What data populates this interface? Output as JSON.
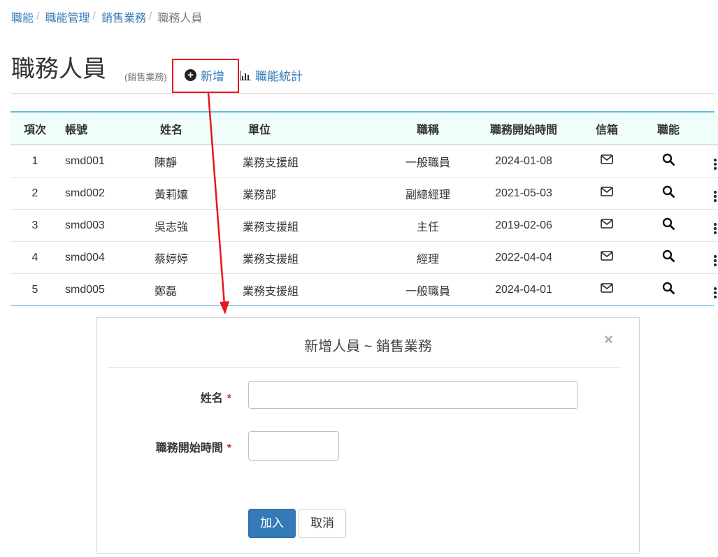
{
  "breadcrumb": {
    "items": [
      "職能",
      "職能管理",
      "銷售業務"
    ],
    "current": "職務人員"
  },
  "header": {
    "title": "職務人員",
    "subtitle": "(銷售業務)",
    "add_label": "新增",
    "stats_label": "職能統計"
  },
  "table": {
    "headers": [
      "項次",
      "帳號",
      "姓名",
      "單位",
      "職稱",
      "職務開始時間",
      "信箱",
      "職能"
    ],
    "rows": [
      {
        "no": "1",
        "account": "smd001",
        "name": "陳靜",
        "unit": "業務支援組",
        "title": "一般職員",
        "start": "2024-01-08"
      },
      {
        "no": "2",
        "account": "smd002",
        "name": "黃莉孃",
        "unit": "業務部",
        "title": "副總經理",
        "start": "2021-05-03"
      },
      {
        "no": "3",
        "account": "smd003",
        "name": "吳志強",
        "unit": "業務支援組",
        "title": "主任",
        "start": "2019-02-06"
      },
      {
        "no": "4",
        "account": "smd004",
        "name": "蔡婷婷",
        "unit": "業務支援組",
        "title": "經理",
        "start": "2022-04-04"
      },
      {
        "no": "5",
        "account": "smd005",
        "name": "鄭磊",
        "unit": "業務支援組",
        "title": "一般職員",
        "start": "2024-04-01"
      }
    ]
  },
  "modal": {
    "title": "新增人員 ~ 銷售業務",
    "close": "×",
    "fields": {
      "name_label": "姓名",
      "start_label": "職務開始時間",
      "required_mark": "*",
      "name_value": "",
      "start_value": ""
    },
    "submit_label": "加入",
    "cancel_label": "取消"
  },
  "colors": {
    "link": "#337ab7",
    "accent_border": "#5bc0de",
    "header_bg": "#effdfb",
    "annotation": "#e8171d",
    "primary_button": "#337ab7"
  },
  "icons": {
    "add": "plus-circle-icon",
    "stats": "bar-chart-icon",
    "mail": "envelope-icon",
    "func": "search-icon",
    "more": "kebab-menu-icon"
  }
}
